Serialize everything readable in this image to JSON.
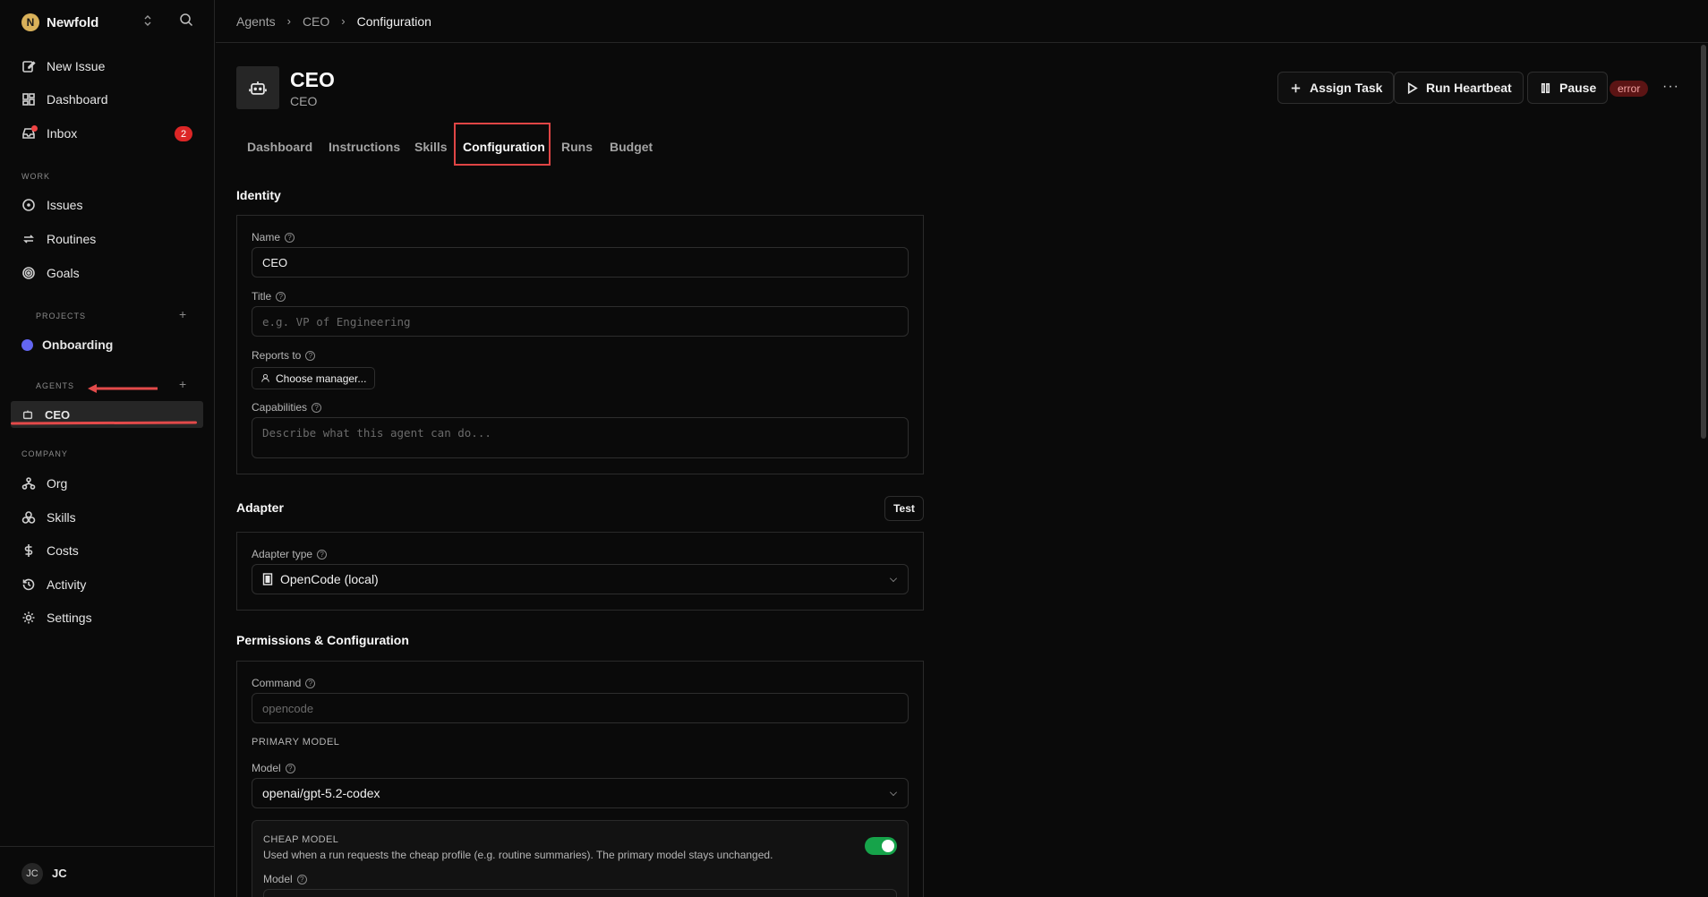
{
  "sidebar": {
    "brand": {
      "logo_letter": "N",
      "name": "Newfold"
    },
    "top_items": [
      {
        "label": "New Issue",
        "icon": "edit-icon"
      },
      {
        "label": "Dashboard",
        "icon": "dashboard-icon"
      },
      {
        "label": "Inbox",
        "icon": "inbox-icon",
        "badge": "2"
      }
    ],
    "work_label": "WORK",
    "work_items": [
      {
        "label": "Issues",
        "icon": "circle-dot-icon"
      },
      {
        "label": "Routines",
        "icon": "repeat-icon"
      },
      {
        "label": "Goals",
        "icon": "target-icon"
      }
    ],
    "projects_label": "PROJECTS",
    "projects": [
      {
        "label": "Onboarding",
        "color": "#6366f1"
      }
    ],
    "agents_label": "AGENTS",
    "agents": [
      {
        "label": "CEO",
        "icon": "bot-icon"
      }
    ],
    "company_label": "COMPANY",
    "company_items": [
      {
        "label": "Org",
        "icon": "org-icon"
      },
      {
        "label": "Skills",
        "icon": "boxes-icon"
      },
      {
        "label": "Costs",
        "icon": "dollar-icon"
      },
      {
        "label": "Activity",
        "icon": "history-icon"
      },
      {
        "label": "Settings",
        "icon": "gear-icon"
      }
    ],
    "user": {
      "initials": "JC",
      "name": "JC"
    }
  },
  "breadcrumb": [
    "Agents",
    "CEO",
    "Configuration"
  ],
  "agent": {
    "name": "CEO",
    "title": "CEO"
  },
  "actions": {
    "assign_task": "Assign Task",
    "run_heartbeat": "Run Heartbeat",
    "pause": "Pause",
    "status": "error",
    "more": "···"
  },
  "tabs": [
    "Dashboard",
    "Instructions",
    "Skills",
    "Configuration",
    "Runs",
    "Budget"
  ],
  "active_tab": "Configuration",
  "identity": {
    "title": "Identity",
    "name_label": "Name",
    "name_value": "CEO",
    "title_label": "Title",
    "title_placeholder": "e.g. VP of Engineering",
    "reports_label": "Reports to",
    "reports_button": "Choose manager...",
    "capabilities_label": "Capabilities",
    "capabilities_placeholder": "Describe what this agent can do..."
  },
  "adapter": {
    "title": "Adapter",
    "test_label": "Test",
    "type_label": "Adapter type",
    "type_value": "OpenCode (local)"
  },
  "permissions": {
    "title": "Permissions & Configuration",
    "command_label": "Command",
    "command_placeholder": "opencode",
    "primary_model_label": "PRIMARY MODEL",
    "model_label": "Model",
    "model_value": "openai/gpt-5.2-codex",
    "cheap_title": "CHEAP MODEL",
    "cheap_desc": "Used when a run requests the cheap profile (e.g. routine summaries). The primary model stays unchanged.",
    "cheap_enabled": true,
    "cheap_model_label": "Model"
  },
  "colors": {
    "accent_red": "#dc2626",
    "toggle_on": "#16a34a",
    "project_dot": "#6366f1"
  }
}
